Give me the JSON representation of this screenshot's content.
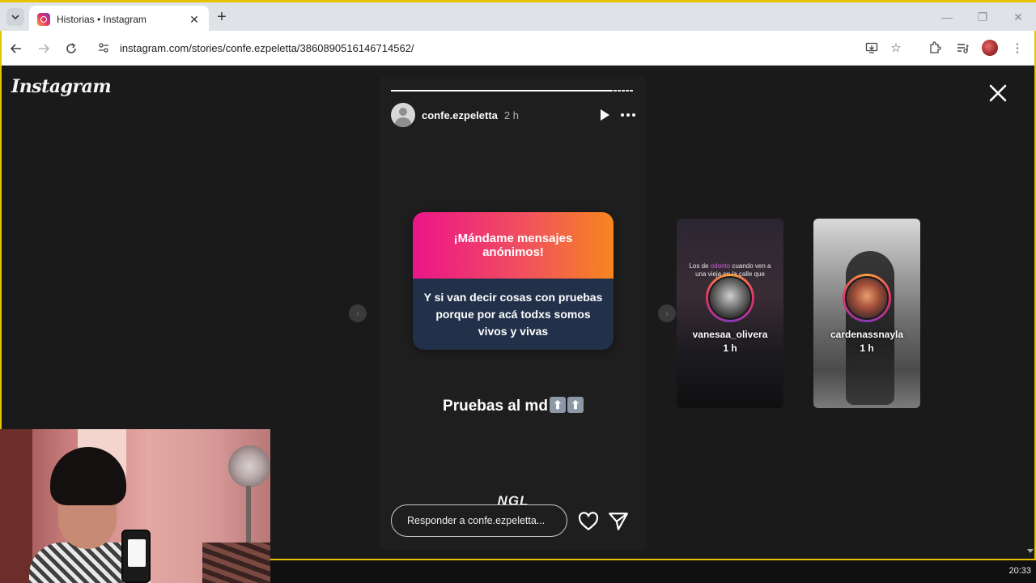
{
  "browser": {
    "tab_title": "Historias • Instagram",
    "new_tab_symbol": "+",
    "url": "instagram.com/stories/confe.ezpeletta/3860890516146714562/"
  },
  "instagram": {
    "logo": "Instagram",
    "story": {
      "username": "confe.ezpeletta",
      "time": "2 h",
      "progress": 0.91,
      "ngl_title": "¡Mándame mensajes anónimos!",
      "ngl_body": "Y si van decir cosas con pruebas porque por acá todxs somos vivos y vivas",
      "caption": "Pruebas al md",
      "watermark": "NGL",
      "reply_placeholder": "Responder a confe.ezpeletta..."
    },
    "previews": [
      {
        "username": "vanesaa_olivera",
        "time": "1 h",
        "inner_text_before": "Los de",
        "inner_text_highlight": "odonto",
        "inner_text_after": "cuando ven a una vieja en la calle que"
      },
      {
        "username": "cardenassnayla",
        "time": "1 h"
      }
    ]
  },
  "taskbar": {
    "clock": "20:33"
  },
  "colors": {
    "ngl_gradient_start": "#ec1487",
    "ngl_gradient_end": "#f6861f",
    "ngl_body_bg": "#22304a",
    "frame_accent": "#e6c200"
  }
}
